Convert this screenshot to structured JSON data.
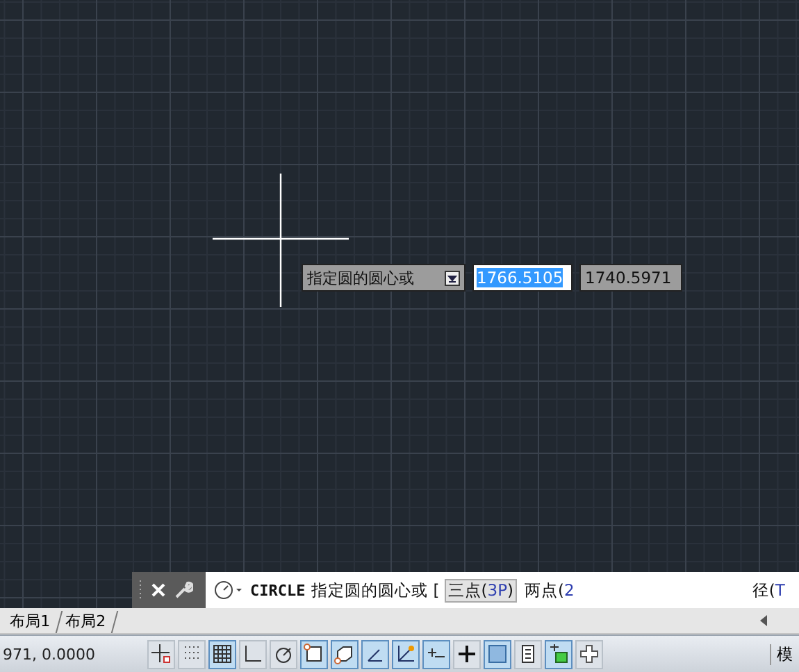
{
  "dynamic_input": {
    "prompt": "指定圆的圆心或",
    "x_value": "1766.5105",
    "y_value": "1740.5971"
  },
  "command_line": {
    "command": "CIRCLE",
    "prompt": "指定圆的圆心或",
    "bracket": "[",
    "options": [
      {
        "text": "三点(",
        "key": "3P",
        "end": ")",
        "highlighted": true
      },
      {
        "text": "两点(",
        "key": "2",
        "highlighted": false
      },
      {
        "text": "径(",
        "key": "T",
        "highlighted": false
      }
    ]
  },
  "layout_tabs": [
    {
      "label": "布局1",
      "selected": false
    },
    {
      "label": "布局2",
      "selected": false
    }
  ],
  "status_bar": {
    "coordinates": "971, 0.0000",
    "toggles": [
      {
        "kind": "snap",
        "on": false
      },
      {
        "kind": "dots",
        "on": false
      },
      {
        "kind": "grid",
        "on": true
      },
      {
        "kind": "ortho",
        "on": false
      },
      {
        "kind": "polar",
        "on": false
      },
      {
        "kind": "osnap",
        "on": true
      },
      {
        "kind": "osnap3d",
        "on": true
      },
      {
        "kind": "otrack",
        "on": true
      },
      {
        "kind": "ducs",
        "on": true
      },
      {
        "kind": "dyn",
        "on": true
      },
      {
        "kind": "lwt",
        "on": false
      },
      {
        "kind": "transparency",
        "on": true
      },
      {
        "kind": "sheet",
        "on": false
      },
      {
        "kind": "cycle",
        "on": true
      },
      {
        "kind": "cross",
        "on": false
      }
    ],
    "model": "模"
  }
}
